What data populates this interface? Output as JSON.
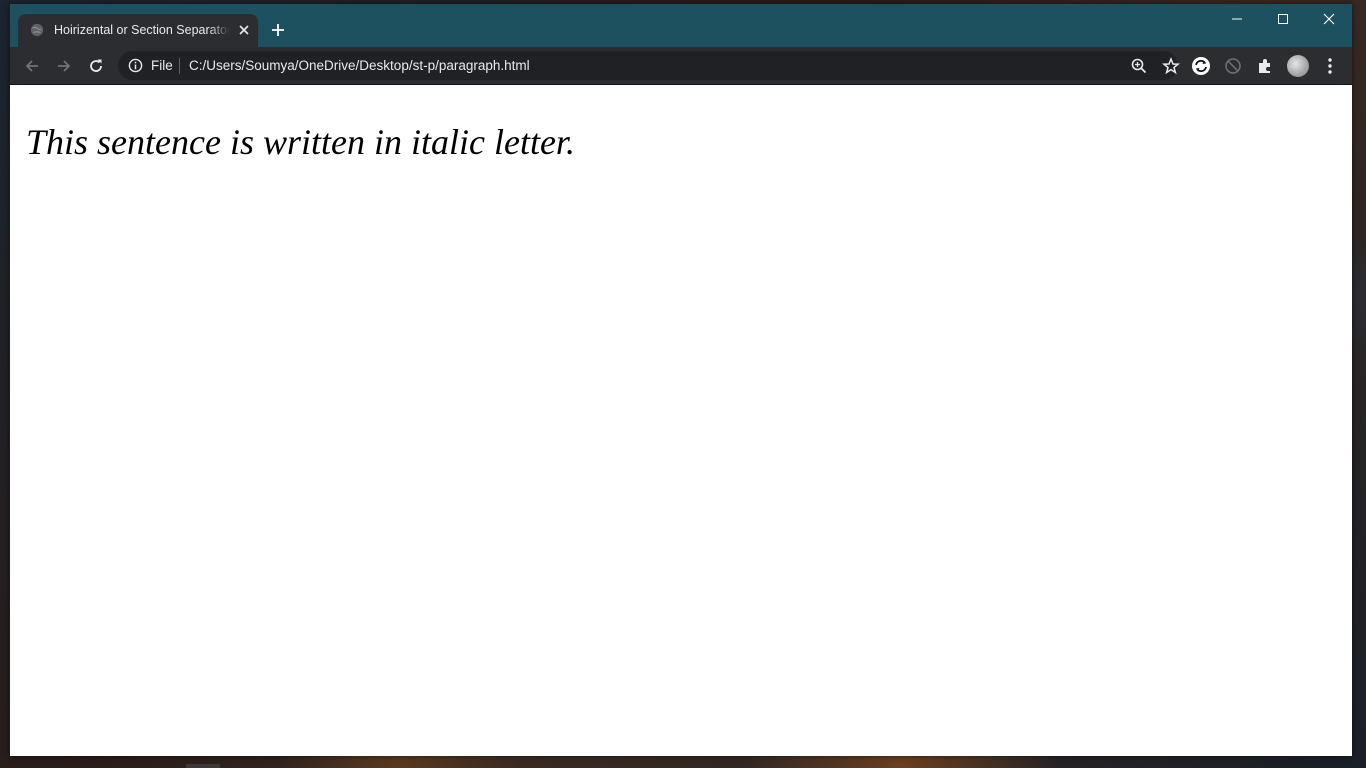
{
  "browser": {
    "tab": {
      "title": "Hoirizental or Section Separator T"
    },
    "toolbar": {
      "scheme_label": "File",
      "url": "C:/Users/Soumya/OneDrive/Desktop/st-p/paragraph.html"
    },
    "colors": {
      "titlebar": "#1d5160",
      "toolbar": "#2b2d30",
      "omnibox": "#202124",
      "text": "#e8eaed"
    }
  },
  "page": {
    "paragraph": "This sentence is written in italic letter."
  }
}
